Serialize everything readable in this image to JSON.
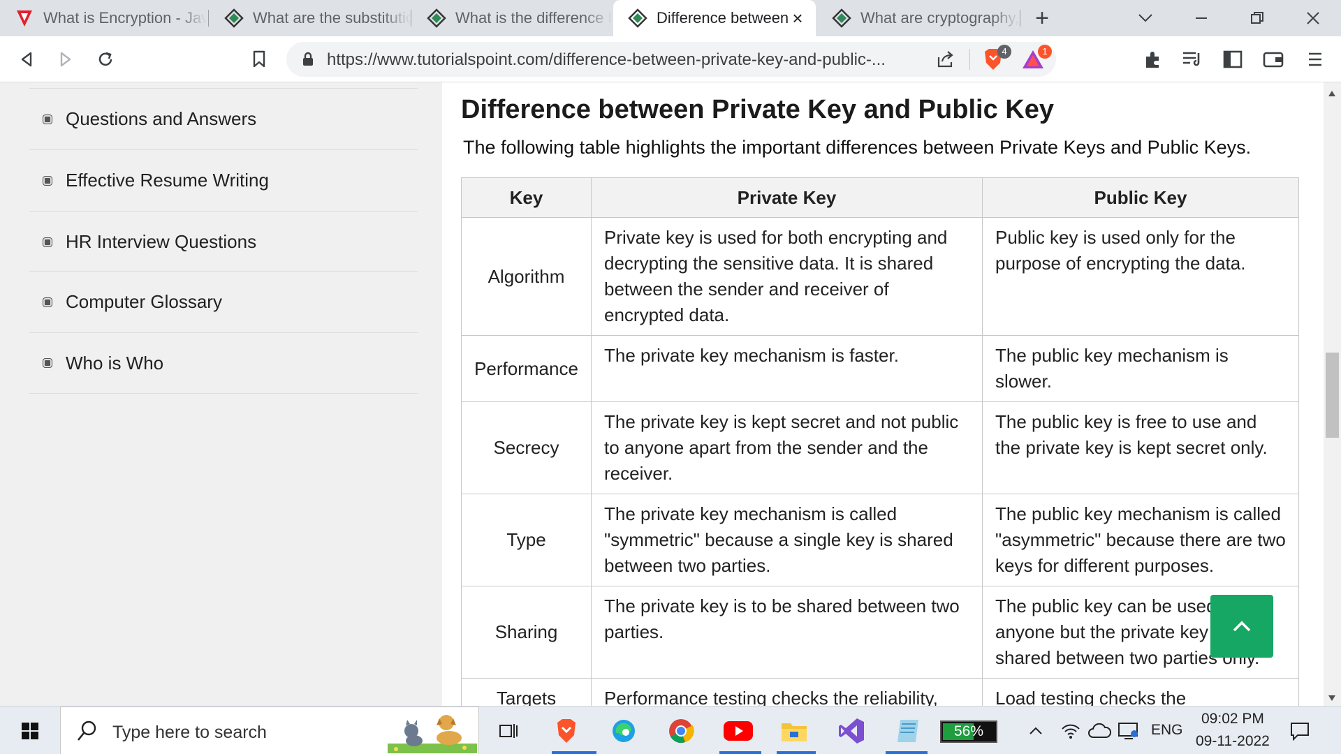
{
  "tabs": [
    {
      "title": "What is Encryption - Jav",
      "icon": "javatpoint-favicon"
    },
    {
      "title": "What are the substitutio",
      "icon": "tutorialspoint-favicon"
    },
    {
      "title": "What is the difference b",
      "icon": "tutorialspoint-favicon"
    },
    {
      "title": "Difference between",
      "icon": "tutorialspoint-favicon",
      "active": true,
      "close": "×"
    },
    {
      "title": "What are cryptography,",
      "icon": "tutorialspoint-favicon"
    }
  ],
  "tabstrip": {
    "new_tab": "+"
  },
  "toolbar": {
    "url": "https://www.tutorialspoint.com/difference-between-private-key-and-public-...",
    "brave_badge": "4",
    "rewards_badge": "1"
  },
  "sidebar": {
    "items": [
      {
        "label": "Questions and Answers"
      },
      {
        "label": "Effective Resume Writing"
      },
      {
        "label": "HR Interview Questions"
      },
      {
        "label": "Computer Glossary"
      },
      {
        "label": "Who is Who"
      }
    ]
  },
  "main": {
    "title": "Difference between Private Key and Public Key",
    "intro": "The following table highlights the important differences between Private Keys and Public Keys.",
    "table": {
      "headers": [
        "Key",
        "Private Key",
        "Public Key"
      ],
      "rows": [
        {
          "key": "Algorithm",
          "private": "Private key is used for both encrypting and decrypting the sensitive data. It is shared between the sender and receiver of encrypted data.",
          "public": "Public key is used only for the purpose of encrypting the data."
        },
        {
          "key": "Performance",
          "private": "The private key mechanism is faster.",
          "public": "The public key mechanism is slower."
        },
        {
          "key": "Secrecy",
          "private": "The private key is kept secret and not public to anyone apart from the sender and the receiver.",
          "public": "The public key is free to use and the private key is kept secret only."
        },
        {
          "key": "Type",
          "private": "The private key mechanism is called \"symmetric\" because a single key is shared between two parties.",
          "public": "The public key mechanism is called \"asymmetric\" because there are two keys for different purposes."
        },
        {
          "key": "Sharing",
          "private": "The private key is to be shared between two parties.",
          "public": "The public key can be used by anyone but the private key is to be shared between two parties only."
        },
        {
          "key": "Targets",
          "private": "Performance testing checks the reliability,",
          "public": "Load testing checks the"
        }
      ]
    }
  },
  "taskbar": {
    "search_placeholder": "Type here to search",
    "battery": "56%",
    "language": "ENG",
    "time": "09:02 PM",
    "date": "09-11-2022"
  },
  "colors": {
    "accent_green": "#16a765",
    "brave_orange": "#fb542b",
    "tab_strip": "#dee1e6"
  }
}
